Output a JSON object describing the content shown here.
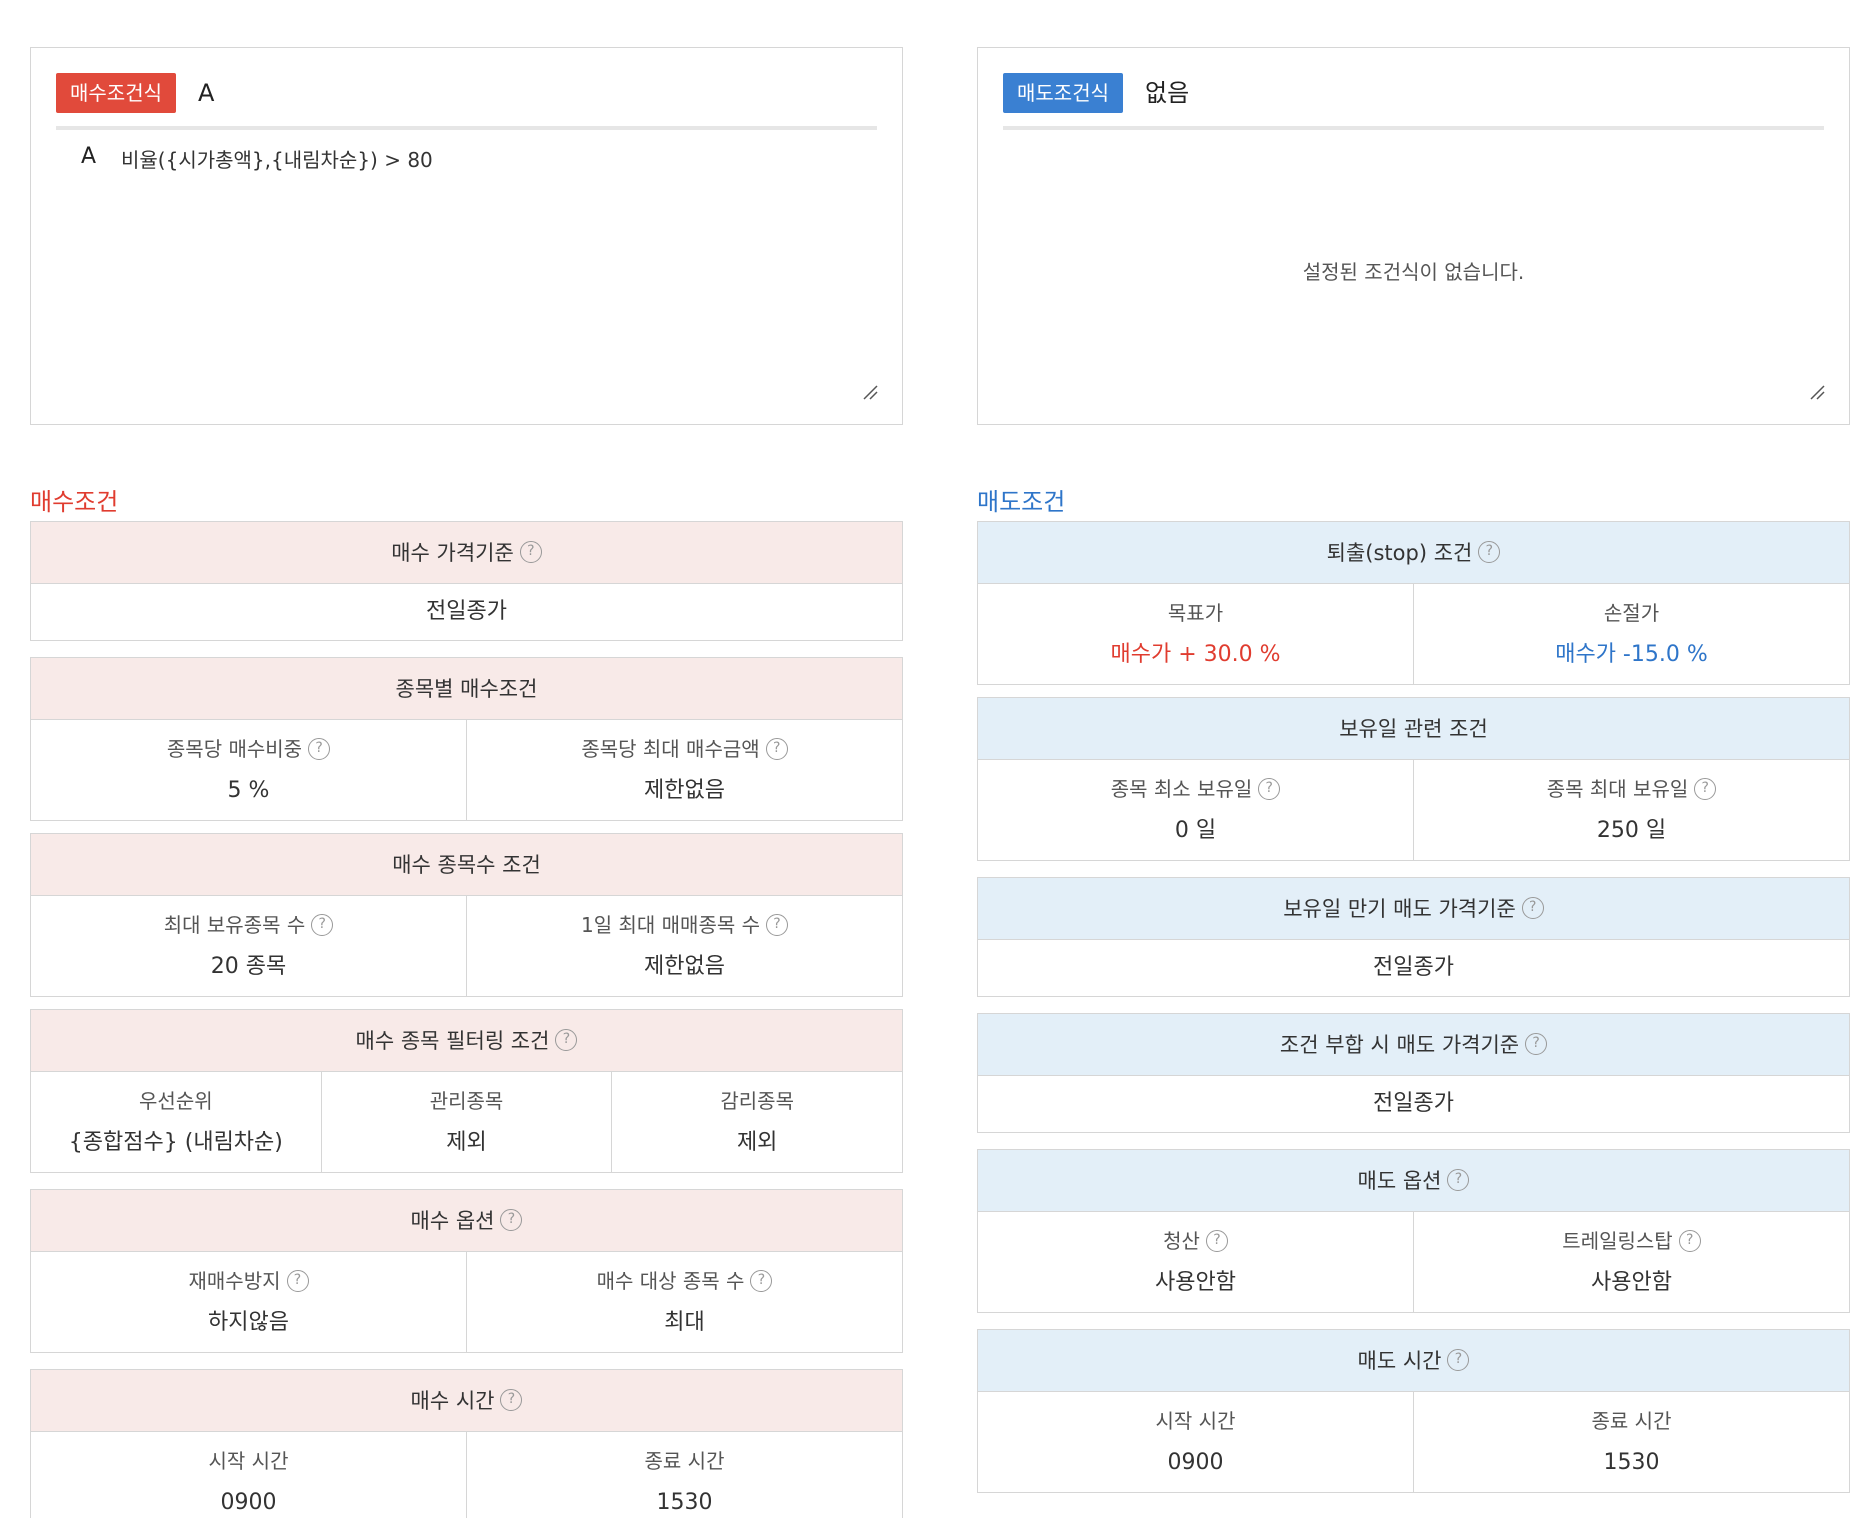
{
  "buy_formula": {
    "tag": "매수조건식",
    "name": "A",
    "rows": [
      {
        "id": "A",
        "expr": "비율({시가총액},{내림차순}) > 80"
      }
    ]
  },
  "sell_formula": {
    "tag": "매도조건식",
    "name": "없음",
    "empty_text": "설정된 조건식이 없습니다."
  },
  "buy": {
    "title": "매수조건",
    "price_basis": {
      "header": "매수 가격기준",
      "value": "전일종가"
    },
    "per_stock": {
      "header": "종목별 매수조건",
      "cells": [
        {
          "label": "종목당 매수비중",
          "value": "5 %"
        },
        {
          "label": "종목당 최대 매수금액",
          "value": "제한없음"
        }
      ]
    },
    "count": {
      "header": "매수 종목수 조건",
      "cells": [
        {
          "label": "최대 보유종목 수",
          "value": "20 종목"
        },
        {
          "label": "1일 최대 매매종목 수",
          "value": "제한없음"
        }
      ]
    },
    "filter": {
      "header": "매수 종목 필터링 조건",
      "cells": [
        {
          "label": "우선순위",
          "value": "{종합점수} (내림차순)"
        },
        {
          "label": "관리종목",
          "value": "제외"
        },
        {
          "label": "감리종목",
          "value": "제외"
        }
      ]
    },
    "options": {
      "header": "매수 옵션",
      "cells": [
        {
          "label": "재매수방지",
          "value": "하지않음"
        },
        {
          "label": "매수 대상 종목 수",
          "value": "최대"
        }
      ]
    },
    "time": {
      "header": "매수 시간",
      "cells": [
        {
          "label": "시작 시간",
          "value": "0900"
        },
        {
          "label": "종료 시간",
          "value": "1530"
        }
      ]
    }
  },
  "sell": {
    "title": "매도조건",
    "stop": {
      "header": "퇴출(stop) 조건",
      "cells": [
        {
          "label": "목표가",
          "value": "매수가 + 30.0 %"
        },
        {
          "label": "손절가",
          "value": "매수가 -15.0 %"
        }
      ]
    },
    "holding": {
      "header": "보유일 관련 조건",
      "cells": [
        {
          "label": "종목 최소 보유일",
          "value": "0 일"
        },
        {
          "label": "종목 최대 보유일",
          "value": "250 일"
        }
      ]
    },
    "expiry_price": {
      "header": "보유일 만기 매도 가격기준",
      "value": "전일종가"
    },
    "match_price": {
      "header": "조건 부합 시 매도 가격기준",
      "value": "전일종가"
    },
    "options": {
      "header": "매도 옵션",
      "cells": [
        {
          "label": "청산",
          "value": "사용안함"
        },
        {
          "label": "트레일링스탑",
          "value": "사용안함"
        }
      ]
    },
    "time": {
      "header": "매도 시간",
      "cells": [
        {
          "label": "시작 시간",
          "value": "0900"
        },
        {
          "label": "종료 시간",
          "value": "1530"
        }
      ]
    }
  },
  "icons": {
    "help": "help-question-icon",
    "resize": "resize-handle-icon"
  },
  "colors": {
    "buy_accent": "#e03c2f",
    "sell_accent": "#2e75c9",
    "buy_header_bg": "#f8eae8",
    "sell_header_bg": "#e3eff8"
  },
  "glyphs": {
    "q": "?"
  }
}
